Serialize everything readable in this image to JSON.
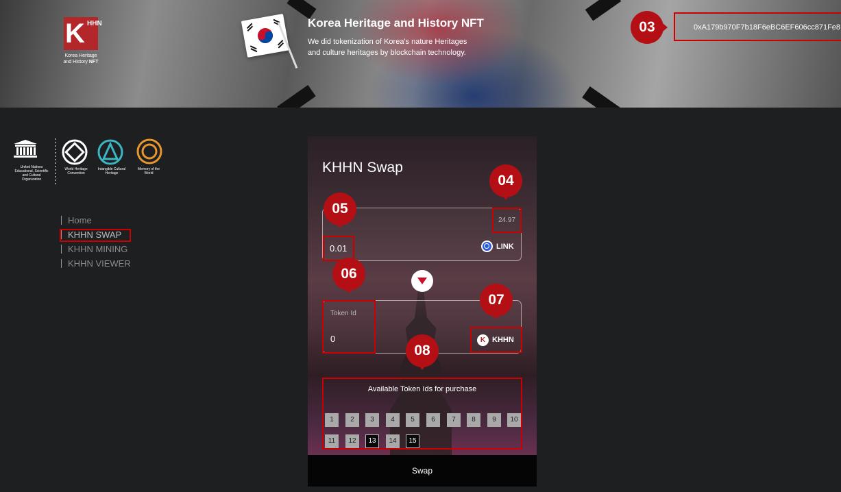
{
  "header": {
    "logo": {
      "letter": "K",
      "sub_letters": "HHN",
      "caption_line1": "Korea Heritage",
      "caption_line2_prefix": "and History",
      "caption_line2_bold": "NFT"
    },
    "title": "Korea Heritage and History NFT",
    "description": "We did tokenization of Korea's nature Heritages and culture heritages by blockchain technology.",
    "wallet_address": "0xA179b970F7b18F6eBC6EF606cc871Fe8"
  },
  "markers": {
    "m03": "03",
    "m04": "04",
    "m05": "05",
    "m06": "06",
    "m07": "07",
    "m08": "08"
  },
  "partners": {
    "unesco": "United Nations Educational, Scientific and Cultural Organization",
    "whc": "World Heritage Convention",
    "ich": "Intangible Cultural Heritage",
    "mow": "Memory of the World"
  },
  "nav": {
    "items": [
      {
        "label": "Home"
      },
      {
        "label": "KHHN SWAP"
      },
      {
        "label": "KHHN MINING"
      },
      {
        "label": "KHHN VIEWER"
      }
    ]
  },
  "swap": {
    "title": "KHHN Swap",
    "balance": "24.97",
    "from_amount": "0.01",
    "from_token": "LINK",
    "to_label": "Token Id",
    "to_value": "0",
    "to_token": "KHHN",
    "to_token_icon": "K",
    "available_title": "Available Token Ids for purchase",
    "token_ids": [
      {
        "id": "1",
        "available": false
      },
      {
        "id": "2",
        "available": false
      },
      {
        "id": "3",
        "available": false
      },
      {
        "id": "4",
        "available": false
      },
      {
        "id": "5",
        "available": false
      },
      {
        "id": "6",
        "available": false
      },
      {
        "id": "7",
        "available": false
      },
      {
        "id": "8",
        "available": false
      },
      {
        "id": "9",
        "available": false
      },
      {
        "id": "10",
        "available": false
      },
      {
        "id": "11",
        "available": false
      },
      {
        "id": "12",
        "available": false
      },
      {
        "id": "13",
        "available": true
      },
      {
        "id": "14",
        "available": false
      },
      {
        "id": "15",
        "available": true
      }
    ],
    "button": "Swap"
  },
  "colors": {
    "accent_red": "#c00000",
    "marker_red": "#b30f14",
    "brand_red": "#b3262a",
    "link_blue": "#2a5ada",
    "background": "#1e1f21"
  }
}
